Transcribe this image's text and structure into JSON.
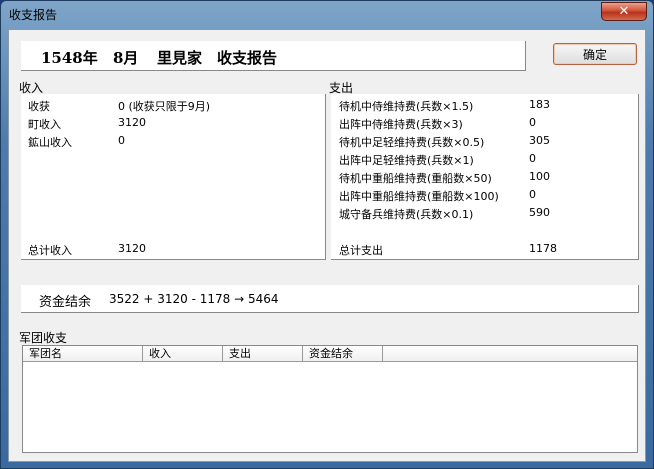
{
  "window": {
    "title": "收支报告",
    "close_icon": "✕"
  },
  "header": {
    "year": "1548年",
    "month": "8月",
    "clan": "里見家",
    "report": "收支报告"
  },
  "ok_button": {
    "label": "确定"
  },
  "income": {
    "title": "收入",
    "rows": [
      {
        "label": "收获",
        "value": "0  (收获只限于9月)"
      },
      {
        "label": "町收入",
        "value": "3120"
      },
      {
        "label": "鉱山收入",
        "value": "0"
      }
    ],
    "total": {
      "label": "总计收入",
      "value": "3120"
    }
  },
  "expense": {
    "title": "支出",
    "rows": [
      {
        "label": "待机中侍维持费(兵数×1.5)",
        "value": "183"
      },
      {
        "label": "出阵中侍维持费(兵数×3)",
        "value": "0"
      },
      {
        "label": "待机中足轻维持费(兵数×0.5)",
        "value": "305"
      },
      {
        "label": "出阵中足轻维持费(兵数×1)",
        "value": "0"
      },
      {
        "label": "待机中重船维持费(重船数×50)",
        "value": "100"
      },
      {
        "label": "出阵中重船维持费(重船数×100)",
        "value": "0"
      },
      {
        "label": "城守备兵维持费(兵数×0.1)",
        "value": "590"
      }
    ],
    "total": {
      "label": "总计支出",
      "value": "1178"
    }
  },
  "balance": {
    "label": "资金结余",
    "formula": "3522 + 3120 - 1178 → 5464"
  },
  "army": {
    "title": "军团收支",
    "columns": [
      "军团名",
      "收入",
      "支出",
      "资金结余"
    ]
  }
}
